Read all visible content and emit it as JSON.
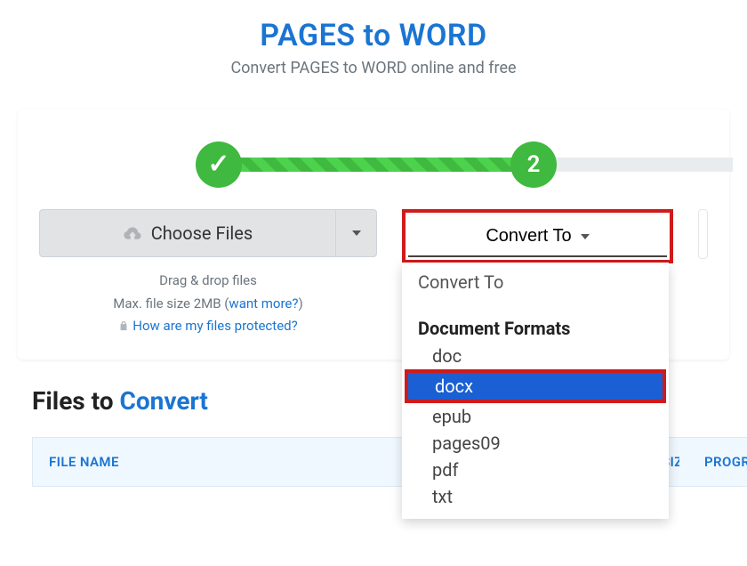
{
  "header": {
    "title": "PAGES to WORD",
    "subtitle": "Convert PAGES to WORD online and free"
  },
  "stepper": {
    "step2_label": "2"
  },
  "choose": {
    "button_label": "Choose Files",
    "drag_text": "Drag & drop files",
    "max_text_prefix": "Max. file size 2MB (",
    "want_more": "want more?",
    "max_text_suffix": ")",
    "protect_link": "How are my files protected?"
  },
  "convert": {
    "button_label": "Convert To",
    "dropdown_header": "Convert To",
    "group_title": "Document Formats",
    "items": {
      "doc": "doc",
      "docx": "docx",
      "epub": "epub",
      "pages09": "pages09",
      "pdf": "pdf",
      "txt": "txt"
    },
    "selected_key": "docx"
  },
  "files": {
    "heading_prefix": "Files to ",
    "heading_accent": "Convert",
    "columns": {
      "name": "FILE NAME",
      "size": "SIZE",
      "progress": "PROGRESS"
    }
  }
}
